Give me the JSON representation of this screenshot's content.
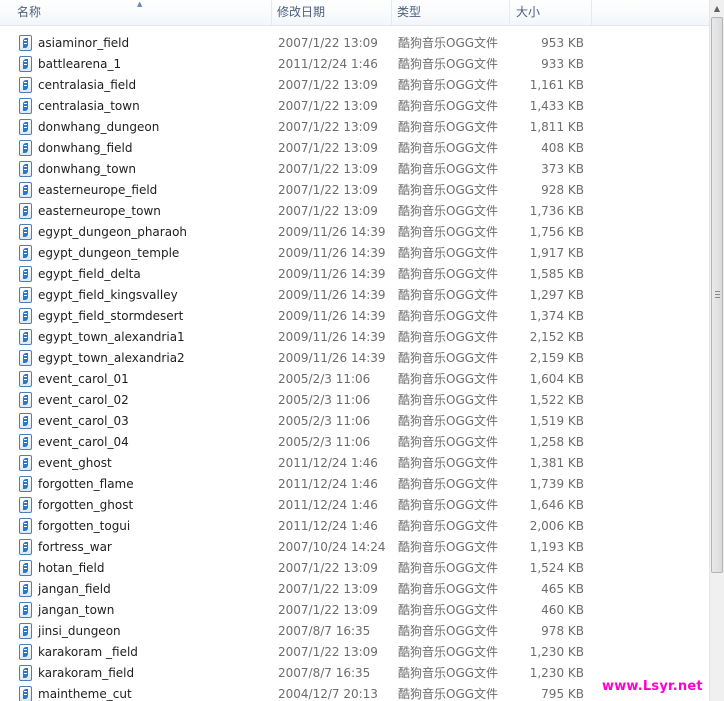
{
  "columns": {
    "name": "名称",
    "date": "修改日期",
    "type": "类型",
    "size": "大小"
  },
  "files": [
    {
      "name": "asiaminor_field",
      "date": "2007/1/22 13:09",
      "type": "酷狗音乐OGG文件",
      "size": "953 KB"
    },
    {
      "name": "battlearena_1",
      "date": "2011/12/24 1:46",
      "type": "酷狗音乐OGG文件",
      "size": "933 KB"
    },
    {
      "name": "centralasia_field",
      "date": "2007/1/22 13:09",
      "type": "酷狗音乐OGG文件",
      "size": "1,161 KB"
    },
    {
      "name": "centralasia_town",
      "date": "2007/1/22 13:09",
      "type": "酷狗音乐OGG文件",
      "size": "1,433 KB"
    },
    {
      "name": "donwhang_dungeon",
      "date": "2007/1/22 13:09",
      "type": "酷狗音乐OGG文件",
      "size": "1,811 KB"
    },
    {
      "name": "donwhang_field",
      "date": "2007/1/22 13:09",
      "type": "酷狗音乐OGG文件",
      "size": "408 KB"
    },
    {
      "name": "donwhang_town",
      "date": "2007/1/22 13:09",
      "type": "酷狗音乐OGG文件",
      "size": "373 KB"
    },
    {
      "name": "easterneurope_field",
      "date": "2007/1/22 13:09",
      "type": "酷狗音乐OGG文件",
      "size": "928 KB"
    },
    {
      "name": "easterneurope_town",
      "date": "2007/1/22 13:09",
      "type": "酷狗音乐OGG文件",
      "size": "1,736 KB"
    },
    {
      "name": "egypt_dungeon_pharaoh",
      "date": "2009/11/26 14:39",
      "type": "酷狗音乐OGG文件",
      "size": "1,756 KB"
    },
    {
      "name": "egypt_dungeon_temple",
      "date": "2009/11/26 14:39",
      "type": "酷狗音乐OGG文件",
      "size": "1,917 KB"
    },
    {
      "name": "egypt_field_delta",
      "date": "2009/11/26 14:39",
      "type": "酷狗音乐OGG文件",
      "size": "1,585 KB"
    },
    {
      "name": "egypt_field_kingsvalley",
      "date": "2009/11/26 14:39",
      "type": "酷狗音乐OGG文件",
      "size": "1,297 KB"
    },
    {
      "name": "egypt_field_stormdesert",
      "date": "2009/11/26 14:39",
      "type": "酷狗音乐OGG文件",
      "size": "1,374 KB"
    },
    {
      "name": "egypt_town_alexandria1",
      "date": "2009/11/26 14:39",
      "type": "酷狗音乐OGG文件",
      "size": "2,152 KB"
    },
    {
      "name": "egypt_town_alexandria2",
      "date": "2009/11/26 14:39",
      "type": "酷狗音乐OGG文件",
      "size": "2,159 KB"
    },
    {
      "name": "event_carol_01",
      "date": "2005/2/3 11:06",
      "type": "酷狗音乐OGG文件",
      "size": "1,604 KB"
    },
    {
      "name": "event_carol_02",
      "date": "2005/2/3 11:06",
      "type": "酷狗音乐OGG文件",
      "size": "1,522 KB"
    },
    {
      "name": "event_carol_03",
      "date": "2005/2/3 11:06",
      "type": "酷狗音乐OGG文件",
      "size": "1,519 KB"
    },
    {
      "name": "event_carol_04",
      "date": "2005/2/3 11:06",
      "type": "酷狗音乐OGG文件",
      "size": "1,258 KB"
    },
    {
      "name": "event_ghost",
      "date": "2011/12/24 1:46",
      "type": "酷狗音乐OGG文件",
      "size": "1,381 KB"
    },
    {
      "name": "forgotten_flame",
      "date": "2011/12/24 1:46",
      "type": "酷狗音乐OGG文件",
      "size": "1,739 KB"
    },
    {
      "name": "forgotten_ghost",
      "date": "2011/12/24 1:46",
      "type": "酷狗音乐OGG文件",
      "size": "1,646 KB"
    },
    {
      "name": "forgotten_togui",
      "date": "2011/12/24 1:46",
      "type": "酷狗音乐OGG文件",
      "size": "2,006 KB"
    },
    {
      "name": "fortress_war",
      "date": "2007/10/24 14:24",
      "type": "酷狗音乐OGG文件",
      "size": "1,193 KB"
    },
    {
      "name": "hotan_field",
      "date": "2007/1/22 13:09",
      "type": "酷狗音乐OGG文件",
      "size": "1,524 KB"
    },
    {
      "name": "jangan_field",
      "date": "2007/1/22 13:09",
      "type": "酷狗音乐OGG文件",
      "size": "465 KB"
    },
    {
      "name": "jangan_town",
      "date": "2007/1/22 13:09",
      "type": "酷狗音乐OGG文件",
      "size": "460 KB"
    },
    {
      "name": "jinsi_dungeon",
      "date": "2007/8/7 16:35",
      "type": "酷狗音乐OGG文件",
      "size": "978 KB"
    },
    {
      "name": "karakoram _field",
      "date": "2007/1/22 13:09",
      "type": "酷狗音乐OGG文件",
      "size": "1,230 KB"
    },
    {
      "name": "karakoram_field",
      "date": "2007/8/7 16:35",
      "type": "酷狗音乐OGG文件",
      "size": "1,230 KB"
    },
    {
      "name": "maintheme_cut",
      "date": "2004/12/7 20:13",
      "type": "酷狗音乐OGG文件",
      "size": "795 KB"
    }
  ],
  "file_icon": "ogg-audio-file-icon",
  "watermark": "www.Lsyr.net",
  "colors": {
    "header_text": "#4c607a",
    "name_text": "#1e1e1e",
    "meta_text": "#6d6d6d",
    "watermark": "#ff00cc"
  }
}
